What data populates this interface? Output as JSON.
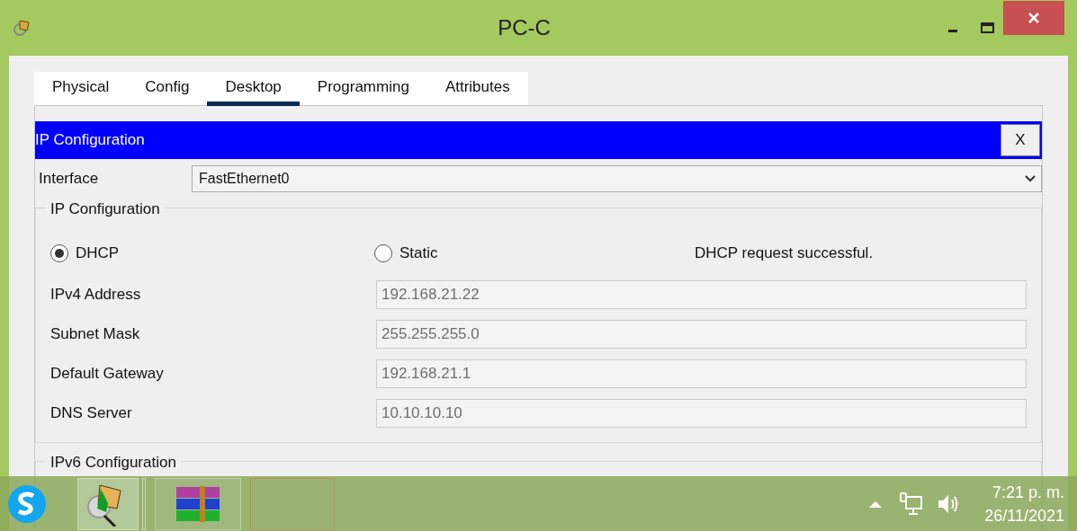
{
  "window": {
    "title": "PC-C"
  },
  "tabs": [
    {
      "label": "Physical",
      "selected": false
    },
    {
      "label": "Config",
      "selected": false
    },
    {
      "label": "Desktop",
      "selected": true
    },
    {
      "label": "Programming",
      "selected": false
    },
    {
      "label": "Attributes",
      "selected": false
    }
  ],
  "panel": {
    "title": "IP Configuration",
    "close": "X"
  },
  "interface": {
    "label": "Interface",
    "value": "FastEthernet0"
  },
  "ipv4": {
    "title": "IP Configuration",
    "modes": [
      {
        "label": "DHCP",
        "selected": true
      },
      {
        "label": "Static",
        "selected": false
      }
    ],
    "status": "DHCP request successful.",
    "fields": [
      {
        "label": "IPv4 Address",
        "value": "192.168.21.22"
      },
      {
        "label": "Subnet Mask",
        "value": "255.255.255.0"
      },
      {
        "label": "Default Gateway",
        "value": "192.168.21.1"
      },
      {
        "label": "DNS Server",
        "value": "10.10.10.10"
      }
    ]
  },
  "ipv6": {
    "title": "IPv6 Configuration"
  },
  "taskbar": {
    "time": "7:21 p. m.",
    "date": "26/11/2021"
  }
}
